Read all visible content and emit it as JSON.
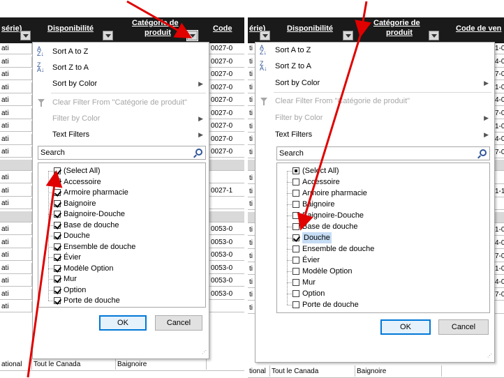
{
  "left": {
    "header": {
      "frag": "série)",
      "disponibilite": "Disponibilité",
      "categorie_l1": "Catégorie de",
      "categorie_l2": "produit",
      "code": "Code"
    },
    "bg_frag_col": [
      "ati",
      "ati",
      "ati",
      "ati",
      "ati",
      "ati",
      "ati",
      "ati",
      "ati",
      "",
      "ati",
      "ati",
      "ati",
      "",
      "ati",
      "ati",
      "ati",
      "ati",
      "ati",
      "ati",
      "ati"
    ],
    "bg_right_col": [
      "0027-0",
      "0027-0",
      "0027-0",
      "0027-0",
      "0027-0",
      "0027-0",
      "0027-0",
      "0027-0",
      "0027-0",
      "",
      "",
      "0027-1",
      "",
      "",
      "0053-0",
      "0053-0",
      "0053-0",
      "0053-0",
      "0053-0",
      "0053-0",
      ""
    ],
    "bottom_row": {
      "col1": "ational",
      "col2": "Tout le Canada",
      "col3": "Baignoire"
    },
    "menu": {
      "sort_az": "Sort A to Z",
      "sort_za": "Sort Z to A",
      "sort_color": "Sort by Color",
      "clear_filter": "Clear Filter From \"Catégorie de produit\"",
      "filter_color": "Filter by Color",
      "text_filters": "Text Filters"
    },
    "search_placeholder": "Search",
    "items": [
      {
        "label": "(Select All)",
        "state": "checked"
      },
      {
        "label": "Accessoire",
        "state": "checked"
      },
      {
        "label": "Armoire pharmacie",
        "state": "checked"
      },
      {
        "label": "Baignoire",
        "state": "checked"
      },
      {
        "label": "Baignoire-Douche",
        "state": "checked"
      },
      {
        "label": "Base de douche",
        "state": "checked"
      },
      {
        "label": "Douche",
        "state": "checked"
      },
      {
        "label": "Ensemble de douche",
        "state": "checked"
      },
      {
        "label": "Évier",
        "state": "checked"
      },
      {
        "label": "Modèle Option",
        "state": "checked"
      },
      {
        "label": "Mur",
        "state": "checked"
      },
      {
        "label": "Option",
        "state": "checked"
      },
      {
        "label": "Porte de douche",
        "state": "checked"
      }
    ],
    "ok": "OK",
    "cancel": "Cancel"
  },
  "right": {
    "header": {
      "frag": "érie)",
      "disponibilite": "Disponibilité",
      "categorie_l1": "Catégorie de",
      "categorie_l2": "produit",
      "code": "Code de ven"
    },
    "bg_frag_col": [
      "ti",
      "ti",
      "ti",
      "ti",
      "ti",
      "ti",
      "ti",
      "ti",
      "ti",
      "",
      "ti",
      "ti",
      "ti",
      "",
      "ti",
      "ti",
      "ti",
      "ti",
      "ti",
      "ti",
      "ti"
    ],
    "bg_right_col": [
      "1-0",
      "4-0",
      "7-0",
      "1-0",
      "4-0",
      "7-0",
      "1-0",
      "4-0",
      "7-0",
      "",
      "",
      "1-1",
      "",
      "",
      "1-0",
      "4-0",
      "7-0",
      "1-0",
      "4-0",
      "7-0",
      ""
    ],
    "bottom_row": {
      "col1": "tional",
      "col2": "Tout le Canada",
      "col3": "Baignoire"
    },
    "menu": {
      "sort_az": "Sort A to Z",
      "sort_za": "Sort Z to A",
      "sort_color": "Sort by Color",
      "clear_filter": "Clear Filter From \"Catégorie de produit\"",
      "filter_color": "Filter by Color",
      "text_filters": "Text Filters"
    },
    "search_placeholder": "Search",
    "items": [
      {
        "label": "(Select All)",
        "state": "partial"
      },
      {
        "label": "Accessoire",
        "state": "unchecked"
      },
      {
        "label": "Armoire pharmacie",
        "state": "unchecked"
      },
      {
        "label": "Baignoire",
        "state": "unchecked"
      },
      {
        "label": "Baignoire-Douche",
        "state": "unchecked"
      },
      {
        "label": "Base de douche",
        "state": "unchecked"
      },
      {
        "label": "Douche",
        "state": "checked"
      },
      {
        "label": "Ensemble de douche",
        "state": "unchecked"
      },
      {
        "label": "Évier",
        "state": "unchecked"
      },
      {
        "label": "Modèle Option",
        "state": "unchecked"
      },
      {
        "label": "Mur",
        "state": "unchecked"
      },
      {
        "label": "Option",
        "state": "unchecked"
      },
      {
        "label": "Porte de douche",
        "state": "unchecked"
      }
    ],
    "ok": "OK",
    "cancel": "Cancel"
  },
  "colors": {
    "header_bg": "#1a1a1a",
    "annotation_arrow": "#e00000",
    "primary_button_border": "#0078d7"
  },
  "icons": {
    "sort_asc": "sort-az-icon",
    "sort_desc": "sort-za-icon",
    "clear_filter": "funnel-clear-icon",
    "search": "search-icon",
    "submenu": "chevron-right-icon"
  }
}
